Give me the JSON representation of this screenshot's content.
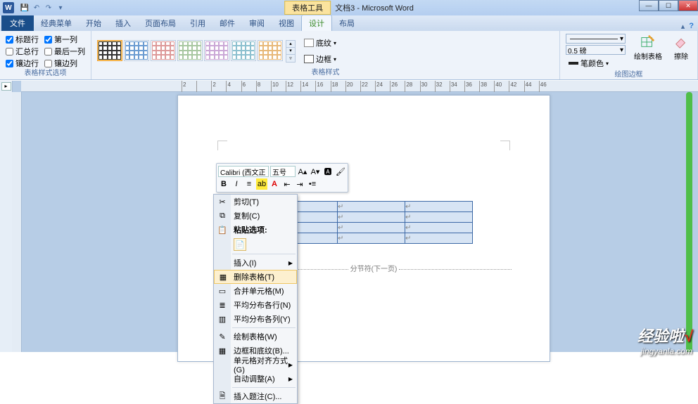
{
  "title": {
    "contextual": "表格工具",
    "doc": "文档3 - Microsoft Word",
    "app_letter": "W"
  },
  "tabs": {
    "file": "文件",
    "classic": "经典菜单",
    "home": "开始",
    "insert": "插入",
    "layout": "页面布局",
    "ref": "引用",
    "mail": "邮件",
    "review": "审阅",
    "view": "视图",
    "design": "设计",
    "tlayout": "布局"
  },
  "ribbon": {
    "opts": {
      "header_row": "标题行",
      "first_col": "第一列",
      "total_row": "汇总行",
      "last_col": "最后一列",
      "banded_row": "镶边行",
      "banded_col": "镶边列",
      "group": "表格样式选项"
    },
    "styles_group": "表格样式",
    "shading": "底纹",
    "borders": "边框",
    "pen_weight": "0.5 磅",
    "pen_color": "笔颜色",
    "draw": "绘制表格",
    "erase": "擦除",
    "draw_group": "绘图边框"
  },
  "mini": {
    "font": "Calibri (西文正",
    "size": "五号"
  },
  "section_break": "分节符(下一页)",
  "menu": {
    "cut": "剪切(T)",
    "copy": "复制(C)",
    "paste_opts": "粘贴选项:",
    "insert": "插入(I)",
    "delete_table": "删除表格(T)",
    "merge": "合并单元格(M)",
    "dist_rows": "平均分布各行(N)",
    "dist_cols": "平均分布各列(Y)",
    "draw": "绘制表格(W)",
    "borders": "边框和底纹(B)...",
    "align": "单元格对齐方式(G)",
    "autofit": "自动调整(A)",
    "caption": "插入题注(C)..."
  },
  "ruler": [
    "2",
    "",
    "2",
    "4",
    "6",
    "8",
    "10",
    "12",
    "14",
    "16",
    "18",
    "20",
    "22",
    "24",
    "26",
    "28",
    "30",
    "32",
    "34",
    "36",
    "38",
    "40",
    "42",
    "44",
    "46"
  ],
  "watermark": {
    "big_a": "经验啦",
    "big_b": "√",
    "small": "jingyanla.com"
  }
}
